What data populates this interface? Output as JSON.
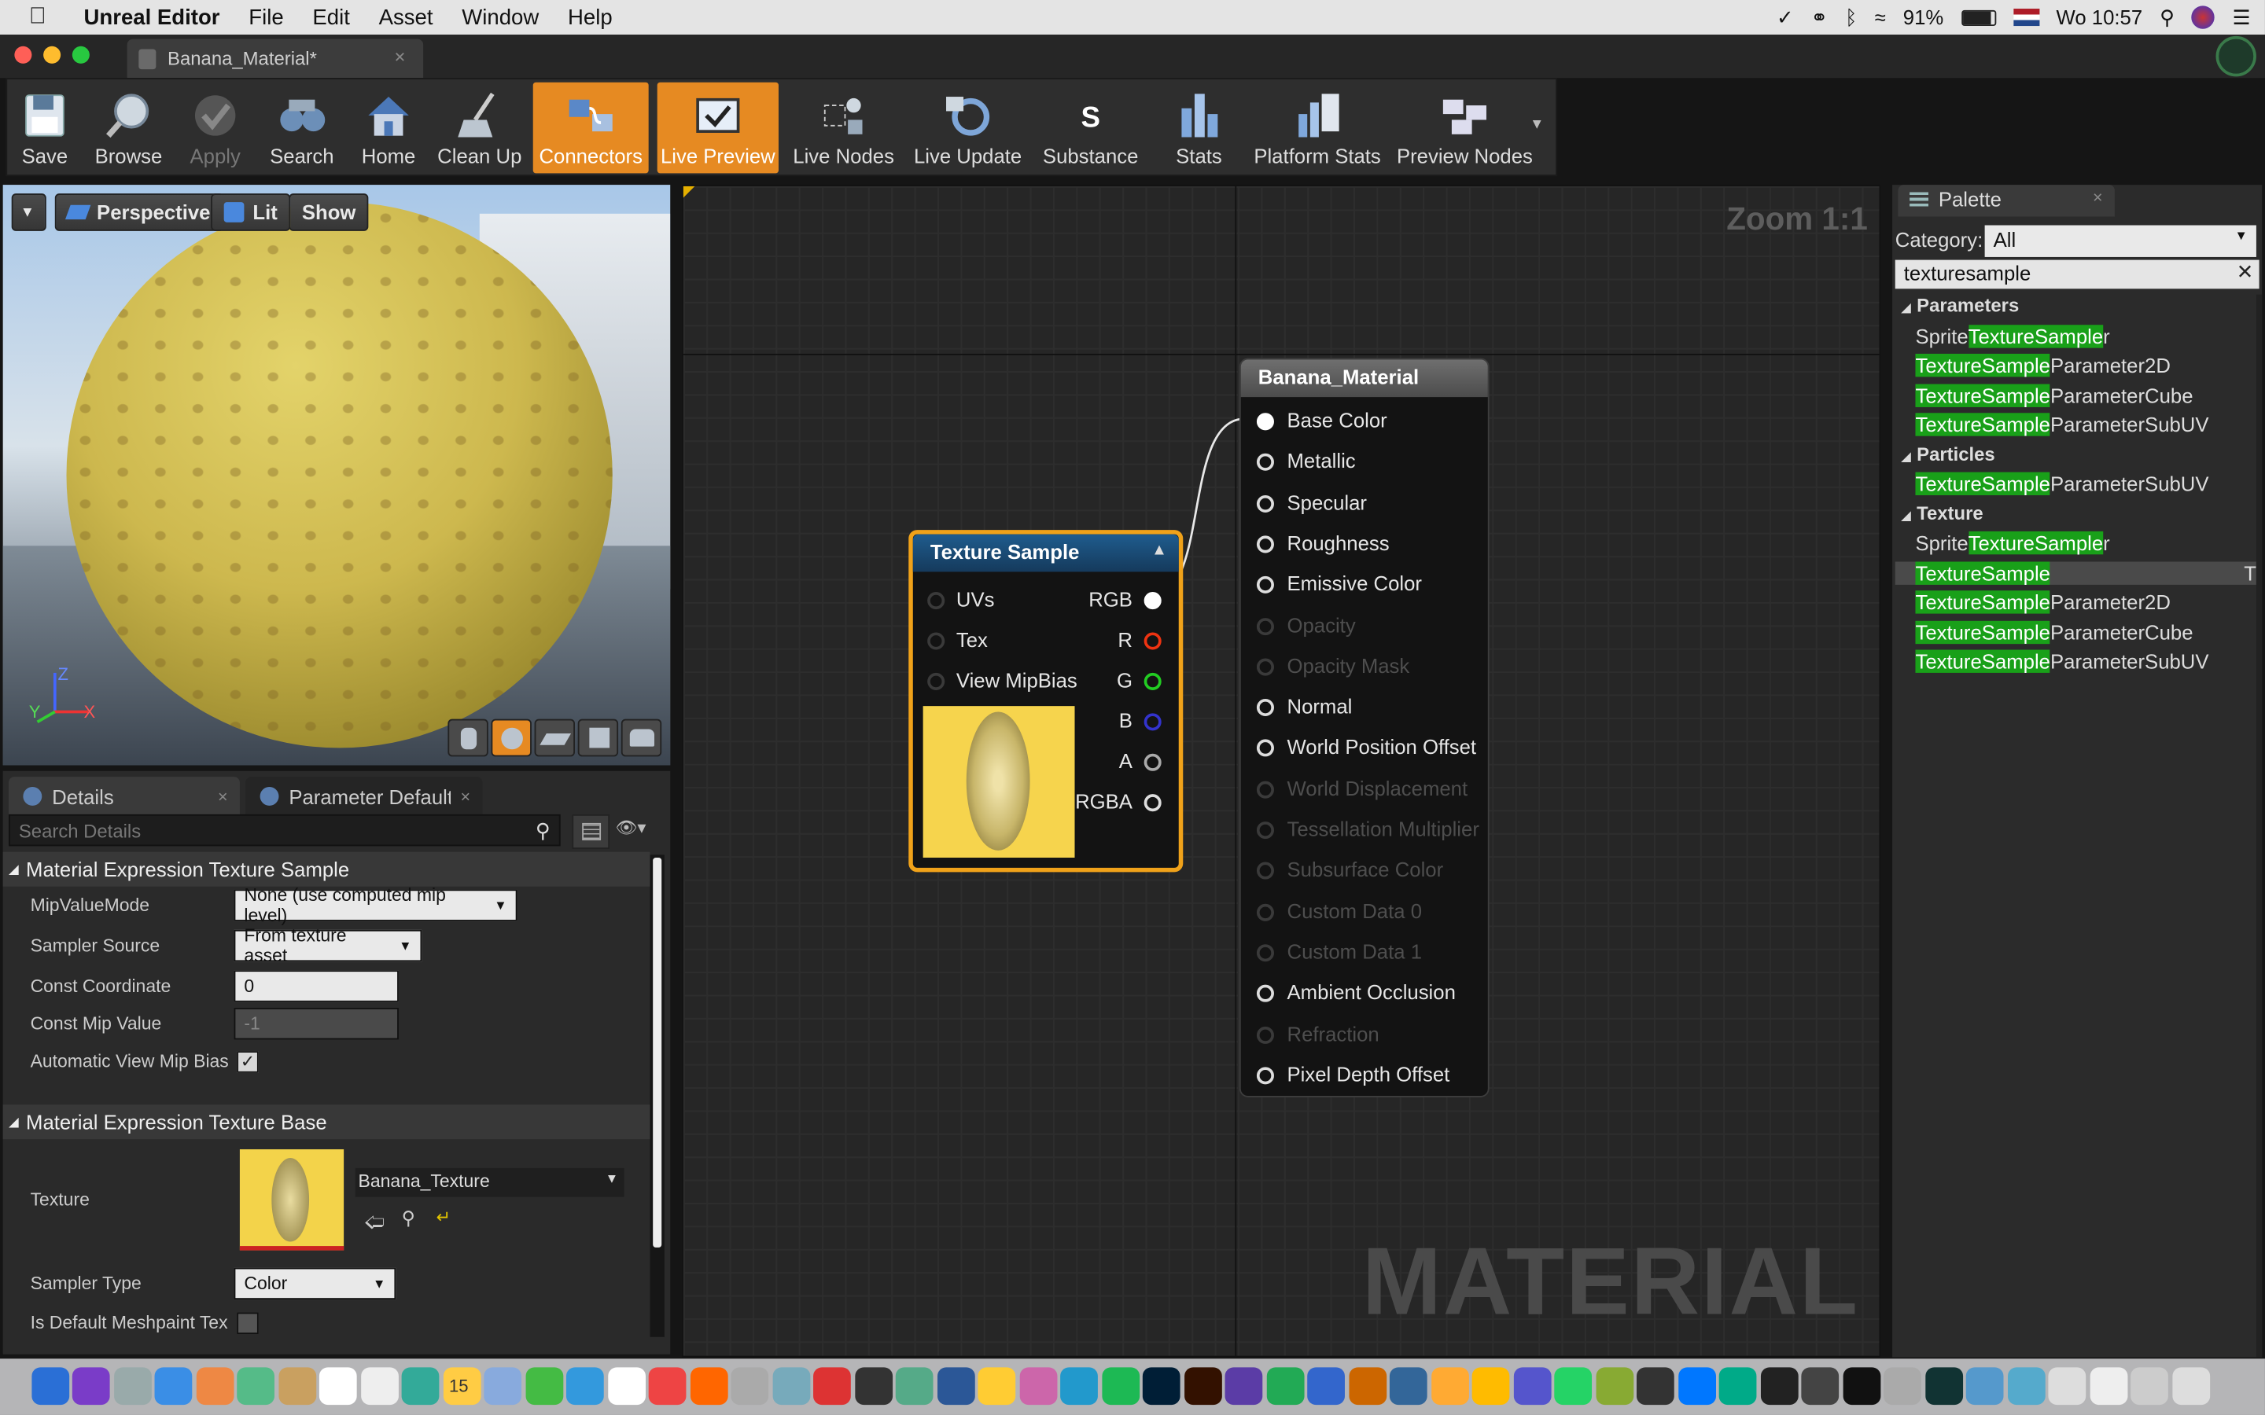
{
  "menubar": {
    "app": "Unreal Editor",
    "items": [
      "File",
      "Edit",
      "Asset",
      "Window",
      "Help"
    ],
    "battery": "91%",
    "clock": "Wo 10:57"
  },
  "window": {
    "tab_title": "Banana_Material*"
  },
  "toolbar": {
    "buttons": [
      {
        "label": "Save",
        "icon": "save-icon"
      },
      {
        "label": "Browse",
        "icon": "browse-icon"
      },
      {
        "label": "Apply",
        "icon": "apply-icon"
      },
      {
        "label": "Search",
        "icon": "search-binoculars-icon"
      },
      {
        "label": "Home",
        "icon": "home-icon"
      },
      {
        "label": "Clean Up",
        "icon": "cleanup-icon"
      },
      {
        "label": "Connectors",
        "icon": "connectors-icon"
      },
      {
        "label": "Live Preview",
        "icon": "live-preview-icon"
      },
      {
        "label": "Live Nodes",
        "icon": "live-nodes-icon"
      },
      {
        "label": "Live Update",
        "icon": "live-update-icon"
      },
      {
        "label": "Substance",
        "icon": "substance-icon"
      },
      {
        "label": "Stats",
        "icon": "stats-icon"
      },
      {
        "label": "Platform Stats",
        "icon": "platform-stats-icon"
      },
      {
        "label": "Preview Nodes",
        "icon": "preview-nodes-icon"
      }
    ]
  },
  "viewport": {
    "perspective": "Perspective",
    "lit": "Lit",
    "show": "Show",
    "axis_z": "Z",
    "axis_y": "Y",
    "axis_x": "X"
  },
  "details": {
    "tab_details": "Details",
    "tab_params": "Parameter Defaults",
    "search_placeholder": "Search Details",
    "section1": "Material Expression Texture Sample",
    "mip_value_mode_label": "MipValueMode",
    "mip_value_mode": "None (use computed mip level)",
    "sampler_source_label": "Sampler Source",
    "sampler_source": "From texture asset",
    "const_coord_label": "Const Coordinate",
    "const_coord": "0",
    "const_mip_label": "Const Mip Value",
    "const_mip": "-1",
    "auto_mip_label": "Automatic View Mip Bias",
    "section2": "Material Expression Texture Base",
    "texture_label": "Texture",
    "texture_value": "Banana_Texture",
    "sampler_type_label": "Sampler Type",
    "sampler_type": "Color",
    "default_meshpaint_label": "Is Default Meshpaint Tex"
  },
  "graph": {
    "zoom": "Zoom 1:1",
    "watermark": "MATERIAL",
    "texture_node": {
      "title": "Texture Sample",
      "inputs": [
        "UVs",
        "Tex",
        "View MipBias"
      ],
      "outputs": [
        "RGB",
        "R",
        "G",
        "B",
        "A",
        "RGBA"
      ]
    },
    "material_node": {
      "title": "Banana_Material",
      "pins": [
        {
          "label": "Base Color",
          "enabled": true
        },
        {
          "label": "Metallic",
          "enabled": true
        },
        {
          "label": "Specular",
          "enabled": true
        },
        {
          "label": "Roughness",
          "enabled": true
        },
        {
          "label": "Emissive Color",
          "enabled": true
        },
        {
          "label": "Opacity",
          "enabled": false
        },
        {
          "label": "Opacity Mask",
          "enabled": false
        },
        {
          "label": "Normal",
          "enabled": true
        },
        {
          "label": "World Position Offset",
          "enabled": true
        },
        {
          "label": "World Displacement",
          "enabled": false
        },
        {
          "label": "Tessellation Multiplier",
          "enabled": false
        },
        {
          "label": "Subsurface Color",
          "enabled": false
        },
        {
          "label": "Custom Data 0",
          "enabled": false
        },
        {
          "label": "Custom Data 1",
          "enabled": false
        },
        {
          "label": "Ambient Occlusion",
          "enabled": true
        },
        {
          "label": "Refraction",
          "enabled": false
        },
        {
          "label": "Pixel Depth Offset",
          "enabled": true
        }
      ]
    }
  },
  "palette": {
    "title": "Palette",
    "category_label": "Category:",
    "category_value": "All",
    "search_value": "texturesample",
    "groups": [
      {
        "name": "Parameters",
        "items": [
          [
            "Sprite",
            "TextureSample",
            "r"
          ],
          [
            "",
            "TextureSample",
            "Parameter2D"
          ],
          [
            "",
            "TextureSample",
            "ParameterCube"
          ],
          [
            "",
            "TextureSample",
            "ParameterSubUV"
          ]
        ]
      },
      {
        "name": "Particles",
        "items": [
          [
            "",
            "TextureSample",
            "ParameterSubUV"
          ]
        ]
      },
      {
        "name": "Texture",
        "items": [
          [
            "Sprite",
            "TextureSample",
            "r"
          ],
          [
            "",
            "TextureSample",
            ""
          ],
          [
            "",
            "TextureSample",
            "Parameter2D"
          ],
          [
            "",
            "TextureSample",
            "ParameterCube"
          ],
          [
            "",
            "TextureSample",
            "ParameterSubUV"
          ]
        ]
      }
    ],
    "selected_suffix": "T"
  },
  "dock": {
    "date_icon": "15"
  }
}
